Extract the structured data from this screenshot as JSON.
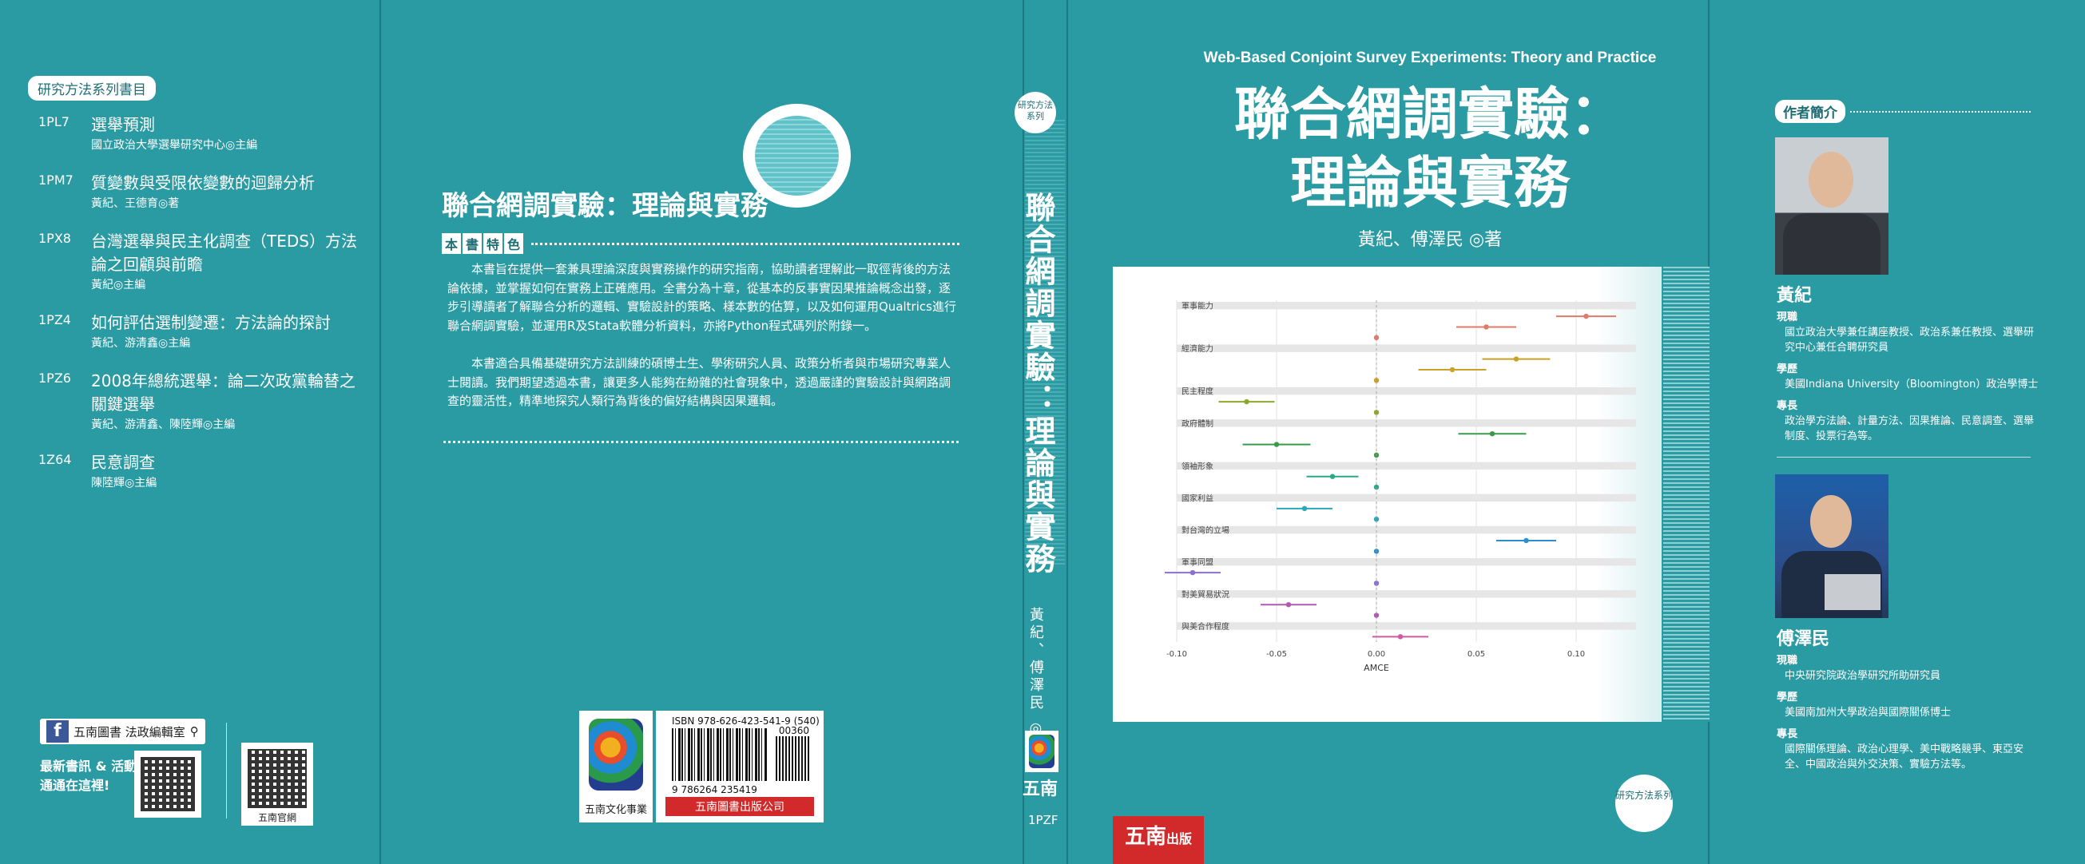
{
  "left_flap": {
    "tag": "研究方法系列書目",
    "items": [
      {
        "code": "1PL7",
        "title": "選舉預測",
        "editor": "國立政治大學選舉研究中心◎主編"
      },
      {
        "code": "1PM7",
        "title": "質變數與受限依變數的迴歸分析",
        "editor": "黃紀、王德育◎著"
      },
      {
        "code": "1PX8",
        "title": "台灣選舉與民主化調查（TEDS）方法論之回顧與前瞻",
        "editor": "黃紀◎主編"
      },
      {
        "code": "1PZ4",
        "title": "如何評估選制變遷：方法論的探討",
        "editor": "黃紀、游清鑫◎主編"
      },
      {
        "code": "1PZ6",
        "title": "2008年總統選舉：論二次政黨輪替之關鍵選舉",
        "editor": "黃紀、游清鑫、陳陸輝◎主編"
      },
      {
        "code": "1Z64",
        "title": "民意調查",
        "editor": "陳陸輝◎主編"
      }
    ],
    "fb_label": "五南圖書 法政編輯室",
    "news_line1": "最新書訊 & 活動",
    "news_line2": "通通在這裡!",
    "qr_label": "五南官網"
  },
  "back": {
    "title": "聯合網調實驗：理論與實務",
    "feature_chars": [
      "本",
      "書",
      "特",
      "色"
    ],
    "para1": "本書旨在提供一套兼具理論深度與實務操作的研究指南，協助讀者理解此一取徑背後的方法論依據，並掌握如何在實務上正確應用。全書分為十章，從基本的反事實因果推論概念出發，逐步引導讀者了解聯合分析的邏輯、實驗設計的策略、樣本數的估算，以及如何運用Qualtrics進行聯合網調實驗，並運用R及Stata軟體分析資料，亦將Python程式碼列於附錄一。",
    "para2": "本書適合具備基礎研究方法訓練的碩博士生、學術研究人員、政策分析者與市場研究專業人士閱讀。我們期望透過本書，讓更多人能夠在紛雜的社會現象中，透過嚴謹的實驗設計與網路調查的靈活性，精準地探究人類行為背後的偏好結構與因果邏輯。",
    "isbn": "ISBN 978-626-423-541-9 (540)",
    "price": "00360",
    "barcode_num": "9 786264 235419",
    "logo_caption": "五南文化事業",
    "publisher": "五南圖書出版公司"
  },
  "spine": {
    "badge": "研究方法系列",
    "title": "聯合網調實驗：理論與實務",
    "authors": "黃紀、傅澤民 ◎著",
    "publisher": "五南",
    "code": "1PZF"
  },
  "front": {
    "en_title": "Web-Based Conjoint Survey Experiments: Theory and Practice",
    "zh_title_line1": "聯合網調實驗：",
    "zh_title_line2": "理論與實務",
    "authors": "黃紀、傅澤民 ◎著",
    "badge": "研究方法系列",
    "red_logo_main": "五南",
    "red_logo_sub": "出版"
  },
  "right_flap": {
    "head": "作者簡介",
    "author1": {
      "name": "黃紀",
      "job_label": "現職",
      "job": "國立政治大學兼任講座教授、政治系兼任教授、選舉研究中心兼任合聘研究員",
      "edu_label": "學歷",
      "edu": "美國Indiana University（Bloomington）政治學博士",
      "spec_label": "專長",
      "spec": "政治學方法論、計量方法、因果推論、民意調查、選舉制度、投票行為等。"
    },
    "author2": {
      "name": "傅澤民",
      "job_label": "現職",
      "job": "中央研究院政治學研究所助研究員",
      "edu_label": "學歷",
      "edu": "美國南加州大學政治與國際關係博士",
      "spec_label": "專長",
      "spec": "國際關係理論、政治心理學、美中戰略競爭、東亞安全、中國政治與外交決策、實驗方法等。"
    }
  },
  "chart_data": {
    "type": "scatter",
    "xlabel": "AMCE",
    "xticks": [
      "-0.10",
      "-0.05",
      "0.00",
      "0.05",
      "0.10"
    ],
    "xlim": [
      -0.1,
      0.13
    ],
    "rows": [
      {
        "kind": "header",
        "label": "軍事能力",
        "color": "#e07b6a"
      },
      {
        "kind": "level",
        "value": 0.105,
        "ci": [
          0.09,
          0.12
        ],
        "color": "#e07b6a"
      },
      {
        "kind": "level",
        "value": 0.055,
        "ci": [
          0.04,
          0.07
        ],
        "color": "#e07b6a"
      },
      {
        "kind": "level",
        "value": 0.0,
        "ci": [
          0.0,
          0.0
        ],
        "color": "#e07b6a"
      },
      {
        "kind": "header",
        "label": "經濟能力",
        "color": "#c9a227"
      },
      {
        "kind": "level",
        "value": 0.07,
        "ci": [
          0.053,
          0.087
        ],
        "color": "#c9a227"
      },
      {
        "kind": "level",
        "value": 0.038,
        "ci": [
          0.021,
          0.055
        ],
        "color": "#c9a227"
      },
      {
        "kind": "level",
        "value": 0.0,
        "ci": [
          0.0,
          0.0
        ],
        "color": "#c9a227"
      },
      {
        "kind": "header",
        "label": "民主程度",
        "color": "#8aa82a"
      },
      {
        "kind": "level",
        "value": -0.065,
        "ci": [
          -0.079,
          -0.051
        ],
        "color": "#8aa82a"
      },
      {
        "kind": "level",
        "value": 0.0,
        "ci": [
          0.0,
          0.0
        ],
        "color": "#8aa82a"
      },
      {
        "kind": "header",
        "label": "政府體制",
        "color": "#3a9a4a"
      },
      {
        "kind": "level",
        "value": 0.058,
        "ci": [
          0.041,
          0.075
        ],
        "color": "#3a9a4a"
      },
      {
        "kind": "level",
        "value": -0.05,
        "ci": [
          -0.067,
          -0.033
        ],
        "color": "#3a9a4a"
      },
      {
        "kind": "level",
        "value": 0.0,
        "ci": [
          0.0,
          0.0
        ],
        "color": "#3a9a4a"
      },
      {
        "kind": "header",
        "label": "領袖形象",
        "color": "#2aa88a"
      },
      {
        "kind": "level",
        "value": -0.022,
        "ci": [
          -0.035,
          -0.009
        ],
        "color": "#2aa88a"
      },
      {
        "kind": "level",
        "value": 0.0,
        "ci": [
          0.0,
          0.0
        ],
        "color": "#2aa88a"
      },
      {
        "kind": "header",
        "label": "國家利益",
        "color": "#2aa8b8"
      },
      {
        "kind": "level",
        "value": -0.036,
        "ci": [
          -0.05,
          -0.022
        ],
        "color": "#2aa8b8"
      },
      {
        "kind": "level",
        "value": 0.0,
        "ci": [
          0.0,
          0.0
        ],
        "color": "#2aa8b8"
      },
      {
        "kind": "header",
        "label": "對台灣的立場",
        "color": "#2a8fd0"
      },
      {
        "kind": "level",
        "value": 0.075,
        "ci": [
          0.06,
          0.09
        ],
        "color": "#2a8fd0"
      },
      {
        "kind": "level",
        "value": 0.0,
        "ci": [
          0.0,
          0.0
        ],
        "color": "#2a8fd0"
      },
      {
        "kind": "header",
        "label": "軍事同盟",
        "color": "#8c6fd0"
      },
      {
        "kind": "level",
        "value": -0.092,
        "ci": [
          -0.106,
          -0.078
        ],
        "color": "#8c6fd0"
      },
      {
        "kind": "level",
        "value": 0.0,
        "ci": [
          0.0,
          0.0
        ],
        "color": "#8c6fd0"
      },
      {
        "kind": "header",
        "label": "對美貿易狀況",
        "color": "#b05ab0"
      },
      {
        "kind": "level",
        "value": -0.044,
        "ci": [
          -0.058,
          -0.03
        ],
        "color": "#b05ab0"
      },
      {
        "kind": "level",
        "value": 0.0,
        "ci": [
          0.0,
          0.0
        ],
        "color": "#b05ab0"
      },
      {
        "kind": "header",
        "label": "與美合作程度",
        "color": "#d05aa0"
      },
      {
        "kind": "level",
        "value": 0.012,
        "ci": [
          -0.002,
          0.026
        ],
        "color": "#d05aa0"
      }
    ]
  }
}
